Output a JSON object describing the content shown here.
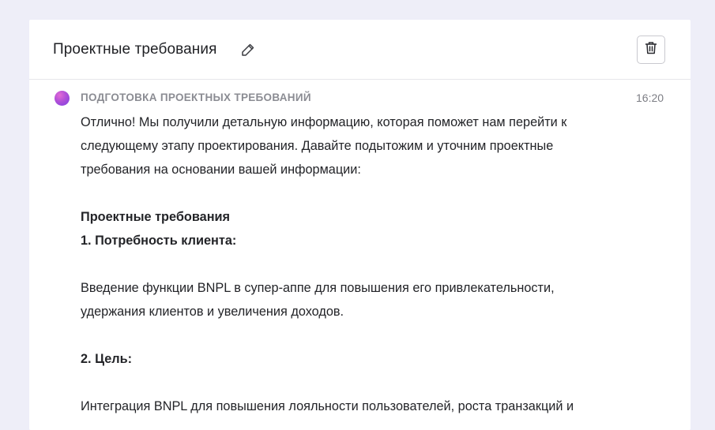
{
  "header": {
    "title": "Проектные требования",
    "edit_icon": "pencil-icon",
    "delete_icon": "trash-icon"
  },
  "message": {
    "sender": "ПОДГОТОВКА ПРОЕКТНЫХ ТРЕБОВАНИЙ",
    "time": "16:20",
    "paragraphs": {
      "intro_line1": "Отлично! Мы получили детальную информацию, которая поможет нам перейти к",
      "intro_line2": "следующему этапу проектирования. Давайте подытожим и уточним проектные",
      "intro_line3": "требования на основании вашей информации:",
      "section_title": "Проектные требования",
      "item1_title": "1. Потребность клиента:",
      "item1_line1": "Введение функции BNPL в супер-аппе для повышения его привлекательности,",
      "item1_line2": "удержания клиентов и увеличения доходов.",
      "item2_title": "2. Цель:",
      "item2_line1": "Интеграция BNPL для повышения лояльности пользователей, роста транзакций и"
    }
  },
  "colors": {
    "page_background": "#eeeef8",
    "card_background": "#ffffff",
    "avatar_gradient_start": "#e26ad6",
    "avatar_gradient_end": "#7c3fe0",
    "muted_text": "#8b8c93"
  }
}
